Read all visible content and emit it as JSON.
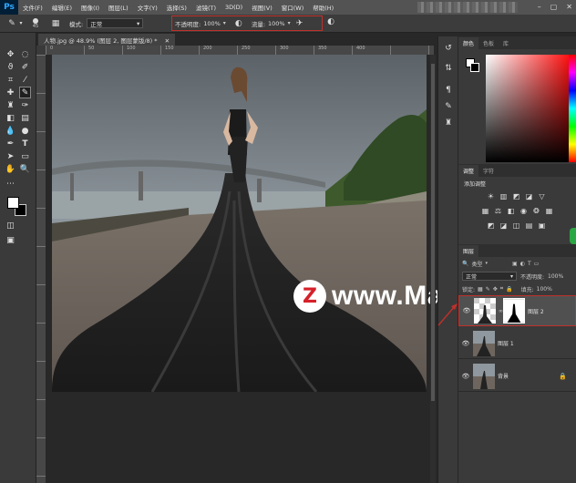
{
  "app": {
    "logo": "Ps"
  },
  "menu": [
    "文件(F)",
    "编辑(E)",
    "图像(I)",
    "图层(L)",
    "文字(Y)",
    "选择(S)",
    "滤镜(T)",
    "3D(D)",
    "视图(V)",
    "窗口(W)",
    "帮助(H)"
  ],
  "options": {
    "brush_size": "45",
    "mode_label": "模式:",
    "mode_value": "正常",
    "opacity_label": "不透明度:",
    "opacity_value": "100%",
    "flow_label": "流量:",
    "flow_value": "100%"
  },
  "document": {
    "tab_title": "人物.jpg @ 48.9% (图层 2, 图层蒙版/8) *",
    "ruler_marks": [
      "0",
      "50",
      "100",
      "150",
      "200",
      "250",
      "300",
      "350",
      "400"
    ]
  },
  "panels": {
    "color_tabs": [
      "颜色",
      "色板",
      "库"
    ],
    "adjust_tabs": [
      "调整",
      "字符"
    ],
    "adjust_title": "添加调整",
    "layer_tab": "图层"
  },
  "layers": {
    "filter_label": "类型",
    "blend_mode": "正常",
    "opacity_label": "不透明度:",
    "opacity_value": "100%",
    "lock_label": "锁定:",
    "fill_label": "填充:",
    "fill_value": "100%",
    "items": [
      {
        "name": "图层 2",
        "selected": true
      },
      {
        "name": "图层 1",
        "selected": false
      },
      {
        "name": "背景",
        "selected": false
      }
    ]
  },
  "watermark": {
    "logo_letter": "Z",
    "text": "www.MacZ.com"
  },
  "colors": {
    "accent_red": "#c0302a",
    "panel_bg": "#3a3a3a",
    "menu_bg": "#535353"
  }
}
